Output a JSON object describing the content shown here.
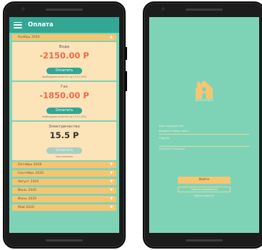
{
  "left_screen": {
    "app_title": "Оплата",
    "expanded_month": "Ноябрь 2020",
    "bills": [
      {
        "name": "Вода",
        "amount": "-2150.00 Р",
        "button": "Оплатить",
        "note": "Необходимо оплатить до 10.12.2020",
        "disabled": false
      },
      {
        "name": "Газ",
        "amount": "-1850.00 Р",
        "button": "Оплатить",
        "note": "Необходимо оплатить до 10.12.2020",
        "disabled": false
      },
      {
        "name": "Электричество",
        "amount": "15.5 Р",
        "button": "Оплатить",
        "note": "Уже оплачено",
        "disabled": true
      }
    ],
    "collapsed_months": [
      "Октябрь 2020",
      "Сентябрь 2020",
      "Август 2020",
      "Июль 2020",
      "Июнь 2020",
      "Май 2020"
    ]
  },
  "right_screen": {
    "logo_caption": "ЖКХ-ОПЛАТА",
    "fields": [
      {
        "label": "Ваш лицевой счёт",
        "value": "Введите номер счёта"
      },
      {
        "label": "Пароль",
        "value": ""
      }
    ],
    "password_hint": "Минимум 6 символов",
    "login_button": "Войти",
    "register_button": "Зарегистрироваться",
    "forgot_link": "Забыли пароль?"
  },
  "colors": {
    "background": "#7ed3b7",
    "appbar": "#33a694",
    "month_bar": "#f6c572",
    "card": "#fde3b8",
    "amount_red": "#ef6a4a"
  }
}
